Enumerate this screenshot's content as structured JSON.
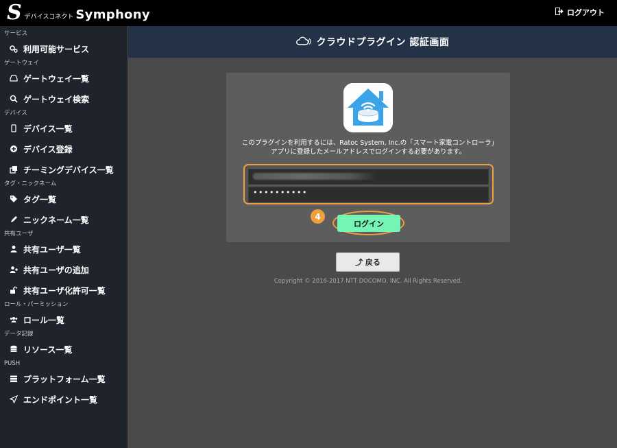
{
  "topbar": {
    "logo_sub": "デバイスコネクト",
    "logo_main": "Symphony",
    "logout_label": "ログアウト"
  },
  "sidebar": {
    "sections": [
      {
        "title": "サービス",
        "items": [
          {
            "label": "利用可能サービス",
            "icon": "gears-icon"
          }
        ]
      },
      {
        "title": "ゲートウェイ",
        "items": [
          {
            "label": "ゲートウェイ一覧",
            "icon": "hdd-icon"
          },
          {
            "label": "ゲートウェイ検索",
            "icon": "search-icon"
          }
        ]
      },
      {
        "title": "デバイス",
        "items": [
          {
            "label": "デバイス一覧",
            "icon": "mobile-icon"
          },
          {
            "label": "デバイス登録",
            "icon": "plus-circle-icon"
          },
          {
            "label": "チーミングデバイス一覧",
            "icon": "clone-icon"
          }
        ]
      },
      {
        "title": "タグ・ニックネーム",
        "items": [
          {
            "label": "タグ一覧",
            "icon": "tags-icon"
          },
          {
            "label": "ニックネーム一覧",
            "icon": "pencil-icon"
          }
        ]
      },
      {
        "title": "共有ユーザ",
        "items": [
          {
            "label": "共有ユーザ一覧",
            "icon": "user-icon"
          },
          {
            "label": "共有ユーザの追加",
            "icon": "user-plus-icon"
          },
          {
            "label": "共有ユーザ化許可一覧",
            "icon": "unlock-icon"
          }
        ]
      },
      {
        "title": "ロール・パーミッション",
        "items": [
          {
            "label": "ロール一覧",
            "icon": "users-icon"
          }
        ]
      },
      {
        "title": "データ記録",
        "items": [
          {
            "label": "リソース一覧",
            "icon": "database-icon"
          }
        ]
      },
      {
        "title": "PUSH",
        "items": [
          {
            "label": "プラットフォーム一覧",
            "icon": "server-icon"
          },
          {
            "label": "エンドポイント一覧",
            "icon": "paper-plane-icon"
          }
        ]
      }
    ]
  },
  "header": {
    "title": "クラウドプラグイン 認証画面"
  },
  "login": {
    "description": "このプラグインを利用するには、Ratoc System, Inc.の「スマート家電コントローラ」アプリに登録したメールアドレスでログインする必要があります。",
    "password_masked": "••••••••••",
    "step_badge": "4",
    "login_label": "ログイン",
    "back_label": "⤴ 戻る"
  },
  "footer": {
    "copyright": "Copyright © 2016-2017 NTT DOCOMO, INC. All Rights Reserved."
  },
  "colors": {
    "accent_orange": "#f0a03a",
    "login_button": "#74f5b6",
    "header_bg": "#243247",
    "sidebar_bg": "#1f232b"
  }
}
